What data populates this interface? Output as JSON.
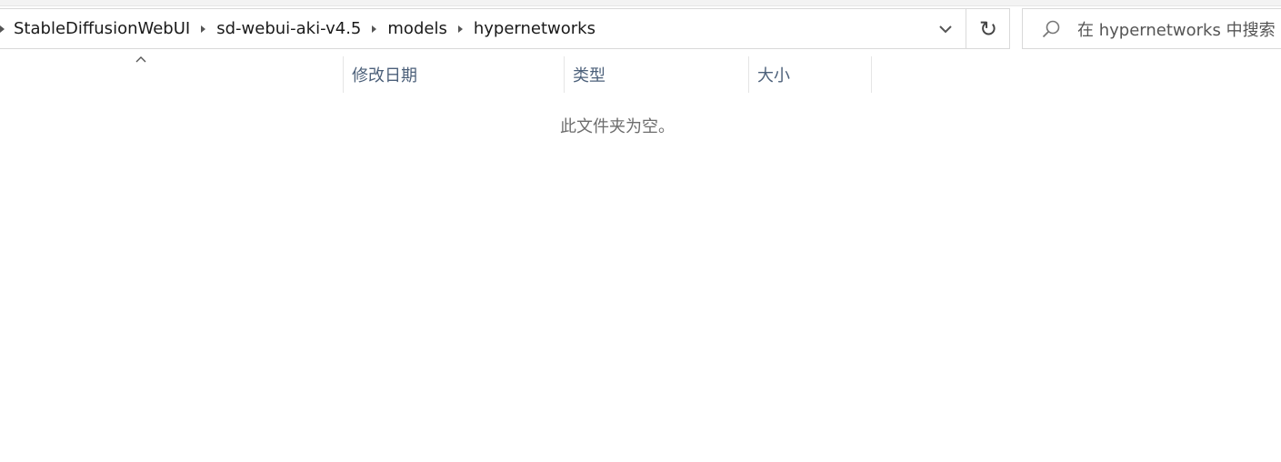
{
  "breadcrumb": {
    "items": [
      {
        "label": "StableDiffusionWebUI"
      },
      {
        "label": "sd-webui-aki-v4.5"
      },
      {
        "label": "models"
      },
      {
        "label": "hypernetworks"
      }
    ]
  },
  "address_controls": {
    "history_icon": "chevron-down-icon",
    "refresh_icon": "refresh-icon",
    "refresh_glyph": "↻"
  },
  "search": {
    "placeholder": "在 hypernetworks 中搜索",
    "icon": "search-icon"
  },
  "columns": {
    "sort_icon": "sort-up-icon",
    "headers": [
      {
        "label": "修改日期"
      },
      {
        "label": "类型"
      },
      {
        "label": "大小"
      }
    ]
  },
  "file_list": {
    "empty_message": "此文件夹为空。"
  }
}
